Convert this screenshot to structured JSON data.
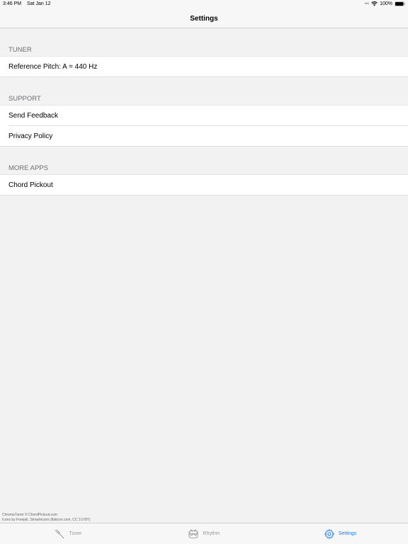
{
  "status_bar": {
    "time": "3:46 PM",
    "date": "Sat Jan 12",
    "battery": "100%"
  },
  "nav": {
    "title": "Settings"
  },
  "sections": {
    "tuner": {
      "header": "TUNER",
      "items": [
        "Reference Pitch: A = 440 Hz"
      ]
    },
    "support": {
      "header": "SUPPORT",
      "items": [
        "Send Feedback",
        "Privacy Policy"
      ]
    },
    "more_apps": {
      "header": "MORE APPS",
      "items": [
        "Chord Pickout"
      ]
    }
  },
  "credits": {
    "line1": "ChromaTuner © ChordPickout.com",
    "line2": "Icons by Freepik, Smashicons (flaticon.com, CC 3.0 BY)"
  },
  "tab_bar": {
    "tabs": [
      {
        "label": "Tuner",
        "icon": "tuning-fork-icon",
        "active": false
      },
      {
        "label": "Rhythm",
        "icon": "drum-icon",
        "active": false
      },
      {
        "label": "Settings",
        "icon": "gear-icon",
        "active": true
      }
    ],
    "active_color": "#1a7df2",
    "inactive_color": "#999999"
  }
}
